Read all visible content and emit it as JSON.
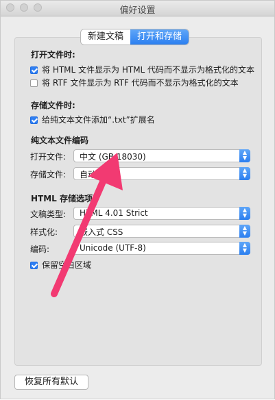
{
  "window": {
    "title": "偏好设置"
  },
  "tabs": [
    {
      "label": "新建文稿",
      "active": false
    },
    {
      "label": "打开和存储",
      "active": true
    }
  ],
  "sections": {
    "open": {
      "title": "打开文件时:",
      "options": [
        {
          "label": "将 HTML 文件显示为 HTML 代码而不显示为格式化的文本",
          "checked": true
        },
        {
          "label": "将 RTF 文件显示为 RTF 代码而不显示为格式化的文本",
          "checked": false
        }
      ]
    },
    "save": {
      "title": "存储文件时:",
      "options": [
        {
          "label": "给纯文本文件添加“.txt”扩展名",
          "checked": true
        }
      ]
    },
    "encoding": {
      "title": "纯文本文件编码",
      "open_label": "打开文件:",
      "open_value": "中文 (GB 18030)",
      "save_label": "存储文件:",
      "save_value": "自动"
    },
    "html": {
      "title": "HTML 存储选项",
      "doctype_label": "文稿类型:",
      "doctype_value": "HTML 4.01 Strict",
      "style_label": "样式化:",
      "style_value": "嵌入式 CSS",
      "encoding_label": "编码:",
      "encoding_value": "Unicode (UTF-8)",
      "preserve_label": "保留空白区域",
      "preserve_checked": true
    }
  },
  "footer": {
    "restore_defaults_label": "恢复所有默认"
  },
  "colors": {
    "accent": "#2b7ff0",
    "annotation_arrow": "#f23a72"
  },
  "icons": {
    "stepper": "up-down-arrows-icon",
    "checkbox": "checkmark-icon"
  }
}
